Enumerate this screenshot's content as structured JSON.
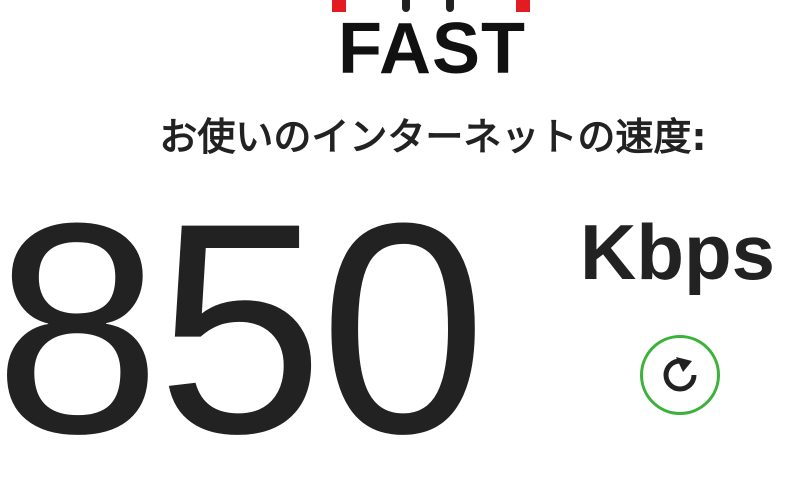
{
  "logo": {
    "text": "FAST"
  },
  "heading": "お使いのインターネットの速度:",
  "speed": {
    "value": "850",
    "units": "Kbps"
  },
  "refresh": {
    "icon": "refresh-icon",
    "color": "#3bb33b"
  },
  "colors": {
    "brand_red": "#e31b23",
    "text": "#222222",
    "accent_green": "#3bb33b"
  }
}
